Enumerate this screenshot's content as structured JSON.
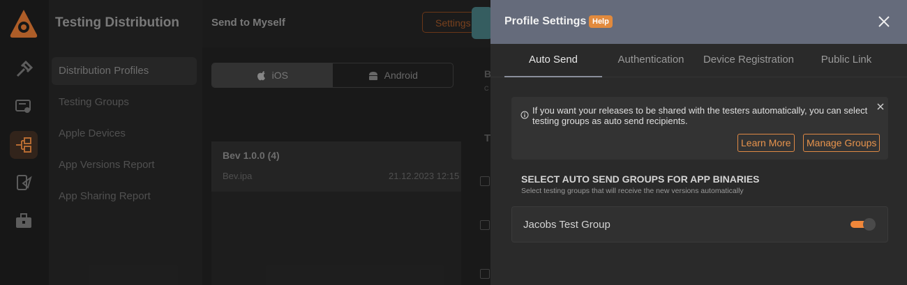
{
  "app": {
    "sidebar_title": "Testing Distribution",
    "sidebar_items": [
      {
        "label": "Distribution Profiles",
        "active": true
      },
      {
        "label": "Testing Groups"
      },
      {
        "label": "Apple Devices"
      },
      {
        "label": "App Versions Report"
      },
      {
        "label": "App Sharing Report"
      }
    ],
    "main_title": "Send to Myself",
    "settings_button": "Settings",
    "platforms": [
      {
        "label": "iOS",
        "active": true
      },
      {
        "label": "Android"
      }
    ],
    "build": {
      "name": "Bev 1.0.0 (4)",
      "file": "Bev.ipa",
      "date": "21.12.2023 12:15"
    },
    "peek_letters": [
      "B",
      "C",
      "T"
    ]
  },
  "drawer": {
    "title": "Profile Settings",
    "help_badge": "Help",
    "tabs": [
      {
        "label": "Auto Send",
        "active": true
      },
      {
        "label": "Authentication"
      },
      {
        "label": "Device Registration"
      },
      {
        "label": "Public Link"
      }
    ],
    "info": {
      "message": "If you want your releases to be shared with the testers automatically, you can select testing groups as auto send recipients.",
      "learn_more": "Learn More",
      "manage_groups": "Manage Groups"
    },
    "section_title": "SELECT AUTO SEND GROUPS FOR APP BINARIES",
    "section_subtitle": "Select testing groups that will receive the new versions automatically",
    "groups": [
      {
        "name": "Jacobs Test Group",
        "enabled": true
      }
    ]
  },
  "colors": {
    "accent": "#f0873a",
    "drawer_header": "#656b7b",
    "drawer_bg": "#2a2a2a"
  }
}
